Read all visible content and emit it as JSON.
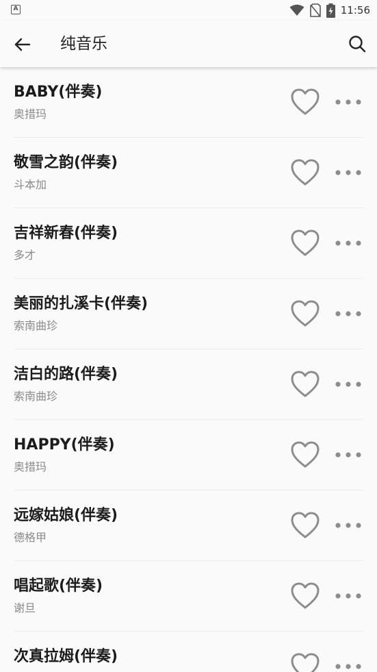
{
  "status_bar": {
    "time": "11:56",
    "notification_icon": "a-icon",
    "icons": [
      "wifi-icon",
      "no-sim-icon",
      "battery-charging-icon"
    ]
  },
  "app_bar": {
    "title": "纯音乐",
    "back_icon": "arrow-left-icon",
    "search_icon": "search-icon"
  },
  "songs": [
    {
      "title": "BABY(伴奏)",
      "artist": "奥措玛"
    },
    {
      "title": "敬雪之韵(伴奏)",
      "artist": "斗本加"
    },
    {
      "title": "吉祥新春(伴奏)",
      "artist": "多才"
    },
    {
      "title": "美丽的扎溪卡(伴奏)",
      "artist": "索南曲珍"
    },
    {
      "title": "洁白的路(伴奏)",
      "artist": "索南曲珍"
    },
    {
      "title": "HAPPY(伴奏)",
      "artist": "奥措玛"
    },
    {
      "title": "远嫁姑娘(伴奏)",
      "artist": "德格甲"
    },
    {
      "title": "唱起歌(伴奏)",
      "artist": "谢旦"
    },
    {
      "title": "次真拉姆(伴奏)",
      "artist": ""
    }
  ],
  "colors": {
    "background": "#fafafa",
    "title_text": "#1c1c1c",
    "artist_text": "#8a8a8a",
    "icon_gray": "#8c8c8c"
  }
}
